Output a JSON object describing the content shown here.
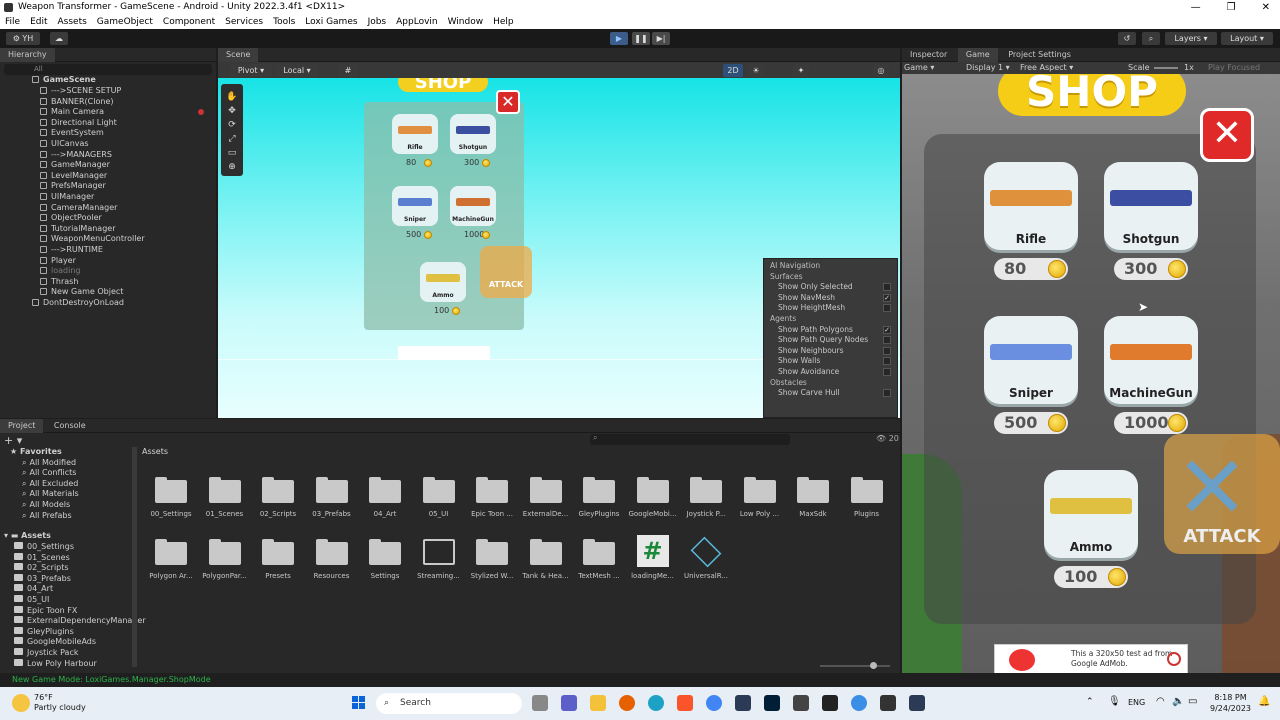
{
  "window": {
    "title": "Weapon Transformer - GameScene - Android - Unity 2022.3.4f1 <DX11>"
  },
  "menu": [
    "File",
    "Edit",
    "Assets",
    "GameObject",
    "Component",
    "Services",
    "Tools",
    "Loxi Games",
    "Jobs",
    "AppLovin",
    "Window",
    "Help"
  ],
  "toolbar": {
    "account": "YH",
    "layers": "Layers",
    "layout": "Layout"
  },
  "hierarchy": {
    "tab": "Hierarchy",
    "search_placeholder": "All",
    "scene": "GameScene",
    "items": [
      "--->SCENE SETUP",
      "BANNER(Clone)",
      "Main Camera",
      "Directional Light",
      "EventSystem",
      "UICanvas",
      "--->MANAGERS",
      "GameManager",
      "LevelManager",
      "PrefsManager",
      "UIManager",
      "CameraManager",
      "ObjectPooler",
      "TutorialManager",
      "WeaponMenuController",
      "--->RUNTIME",
      "Player",
      "loading",
      "Thrash",
      "New Game Object"
    ],
    "ddol": "DontDestroyOnLoad"
  },
  "scene": {
    "tab": "Scene",
    "pivot": "Pivot",
    "local": "Local",
    "twod": "2D",
    "shop_title": "SHOP",
    "items": [
      {
        "name": "Rifle",
        "price": "80"
      },
      {
        "name": "Shotgun",
        "price": "300"
      },
      {
        "name": "Sniper",
        "price": "500"
      },
      {
        "name": "MachineGun",
        "price": "1000"
      },
      {
        "name": "Ammo",
        "price": "100"
      }
    ],
    "attack": "ATTACK",
    "ainav": {
      "title": "AI Navigation",
      "surfaces": "Surfaces",
      "surface_items": [
        "Show Only Selected",
        "Show NavMesh",
        "Show HeightMesh"
      ],
      "agents": "Agents",
      "agent_items": [
        "Show Path Polygons",
        "Show Path Query Nodes",
        "Show Neighbours",
        "Show Walls",
        "Show Avoidance"
      ],
      "obstacles": "Obstacles",
      "obstacle_items": [
        "Show Carve Hull"
      ]
    }
  },
  "right": {
    "tabs": [
      "Inspector",
      "Game",
      "Project Settings"
    ],
    "game_mode": "Game",
    "display": "Display 1",
    "aspect": "Free Aspect",
    "scale_label": "Scale",
    "scale_value": "1x",
    "play_focused": "Play Focused",
    "shop_title": "SHOP",
    "items": [
      {
        "name": "Rifle",
        "price": "80"
      },
      {
        "name": "Shotgun",
        "price": "300"
      },
      {
        "name": "Sniper",
        "price": "500"
      },
      {
        "name": "MachineGun",
        "price": "1000"
      },
      {
        "name": "Ammo",
        "price": "100"
      }
    ],
    "attack": "ATTACK",
    "ad_text": "This a 320x50 test ad from Google AdMob."
  },
  "project": {
    "tabs": [
      "Project",
      "Console"
    ],
    "favorites": "Favorites",
    "fav_items": [
      "All Modified",
      "All Conflicts",
      "All Excluded",
      "All Materials",
      "All Models",
      "All Prefabs"
    ],
    "assets_root": "Assets",
    "tree_items": [
      "00_Settings",
      "01_Scenes",
      "02_Scripts",
      "03_Prefabs",
      "04_Art",
      "05_UI",
      "Epic Toon FX",
      "ExternalDependencyManager",
      "GleyPlugins",
      "GoogleMobileAds",
      "Joystick Pack",
      "Low Poly Harbour"
    ],
    "breadcrumb": "Assets",
    "hidden_count": "20",
    "grid_row1": [
      "00_Settings",
      "01_Scenes",
      "02_Scripts",
      "03_Prefabs",
      "04_Art",
      "05_UI",
      "Epic Toon ...",
      "ExternalDe...",
      "GleyPlugins",
      "GoogleMobi...",
      "Joystick P...",
      "Low Poly ...",
      "MaxSdk",
      "Plugins"
    ],
    "grid_row2": [
      "Polygon Ar...",
      "PolygonPar...",
      "Presets",
      "Resources",
      "Settings",
      "Streaming...",
      "Stylized W...",
      "Tank & Hea...",
      "TextMesh ...",
      "loadingMe...",
      "UniversalR..."
    ]
  },
  "status": {
    "message": "New Game Mode: LoxiGames.Manager.ShopMode"
  },
  "taskbar": {
    "weather_temp": "76°F",
    "weather_desc": "Partly cloudy",
    "search": "Search",
    "lang": "ENG",
    "time": "8:18 PM",
    "date": "9/24/2023"
  }
}
